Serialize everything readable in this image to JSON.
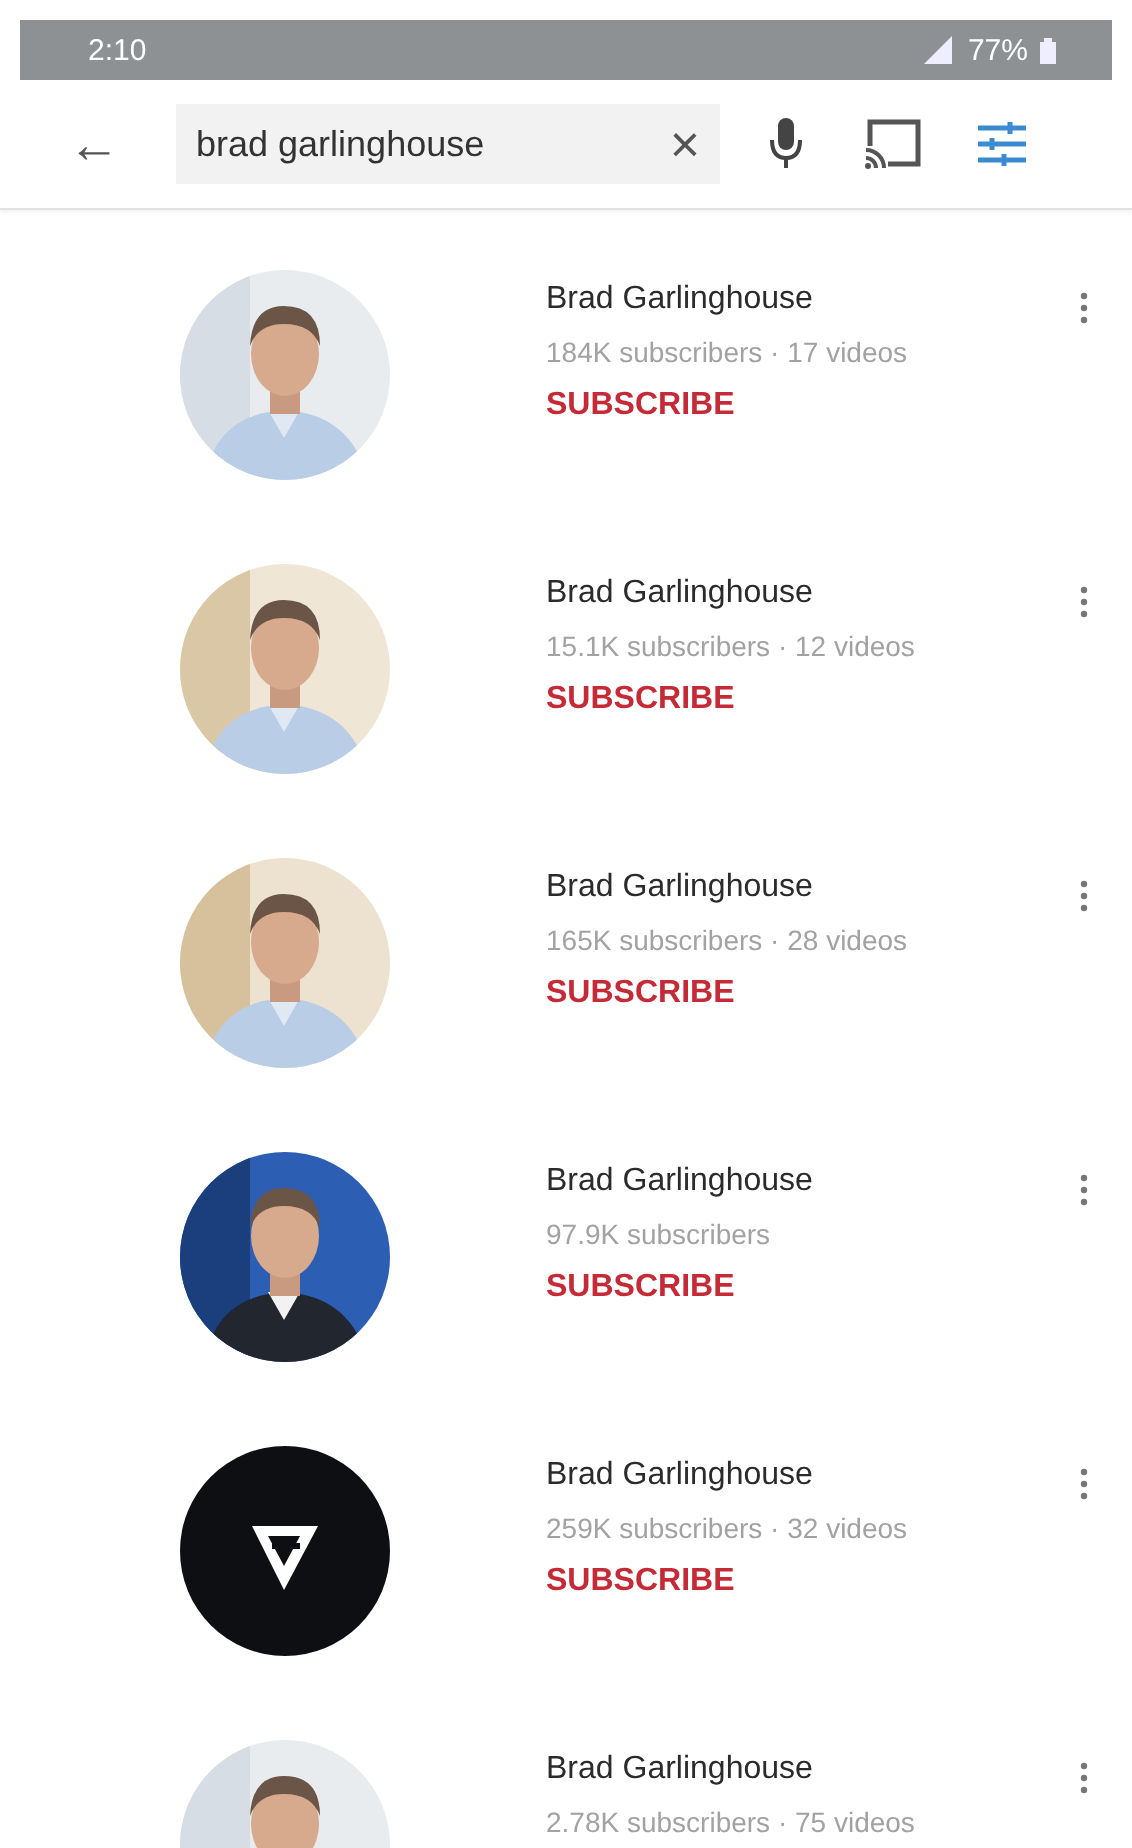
{
  "status_bar": {
    "time": "2:10",
    "battery": "77%"
  },
  "search": {
    "back_icon": "←",
    "value": "brad garlinghouse",
    "clear_icon": "×"
  },
  "results": [
    {
      "kind": "picture",
      "name": "Brad Garlinghouse",
      "meta": "184K subscribers · 17 videos",
      "subscribe_label": "SUBSCRIBE"
    },
    {
      "kind": "picture",
      "name": "Brad Garlinghouse",
      "meta": "15.1K subscribers · 12 videos",
      "subscribe_label": "SUBSCRIBE"
    },
    {
      "kind": "picture",
      "name": "Brad Garlinghouse",
      "meta": "165K subscribers · 28 videos",
      "subscribe_label": "SUBSCRIBE"
    },
    {
      "kind": "picture",
      "name": "Brad Garlinghouse",
      "meta": "97.9K subscribers",
      "subscribe_label": "SUBSCRIBE"
    },
    {
      "kind": "logo",
      "name": "Brad Garlinghouse",
      "meta": "259K subscribers · 32 videos",
      "subscribe_label": "SUBSCRIBE"
    },
    {
      "kind": "picture",
      "name": "Brad Garlinghouse",
      "meta": "2.78K subscribers · 75 videos"
    }
  ]
}
